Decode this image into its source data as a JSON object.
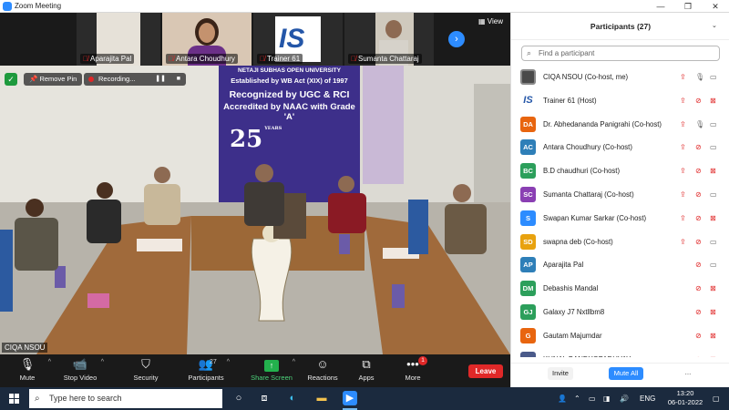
{
  "window": {
    "title": "Zoom Meeting"
  },
  "strip": {
    "view_label": "View",
    "tiles": [
      {
        "name": "Aparajita Pal",
        "muted": true
      },
      {
        "name": "Antara Choudhury",
        "muted": true
      },
      {
        "name": "Trainer 61",
        "muted": true
      },
      {
        "name": "Sumanta Chattaraj",
        "muted": true
      }
    ],
    "next_icon": "chevron-right-icon"
  },
  "overlays": {
    "remove_pin_label": "Remove Pin",
    "recording_label": "Recording...",
    "security_badge_icon": "shield-check-icon"
  },
  "speaker": {
    "name": "CIQA NSOU"
  },
  "banner": {
    "title": "NETAJI SUBHAS OPEN UNIVERSITY",
    "line1": "Established by WB Act (XIX) of 1997",
    "line2": "Recognized by UGC & RCI",
    "line3": "Accredited by NAAC with Grade 'A'",
    "years_num": "25",
    "years_label": "YEARS"
  },
  "toolbar": {
    "mute": "Mute",
    "stop_video": "Stop Video",
    "security": "Security",
    "participants": "Participants",
    "participants_count": "27",
    "share_screen": "Share Screen",
    "reactions": "Reactions",
    "apps": "Apps",
    "more": "More",
    "more_badge": "1",
    "leave": "Leave"
  },
  "panel": {
    "title": "Participants (27)",
    "search_placeholder": "Find a participant",
    "participants": [
      {
        "initials": "",
        "color": "#4a4a4a",
        "name": "CIQA NSOU (Co-host, me)",
        "mic": "on",
        "video": "on",
        "share": true
      },
      {
        "initials": "IS",
        "color": "#ffffff",
        "name": "Trainer 61 (Host)",
        "mic": "muted",
        "video": "off",
        "share": true
      },
      {
        "initials": "DA",
        "color": "#e8650f",
        "name": "Dr. Abhedananda Panigrahi (Co-host)",
        "mic": "on",
        "video": "on",
        "share": true
      },
      {
        "initials": "AC",
        "color": "#2e7fb8",
        "name": "Antara Choudhury (Co-host)",
        "mic": "muted",
        "video": "on",
        "share": true
      },
      {
        "initials": "BC",
        "color": "#2c9f5b",
        "name": "B.D chaudhuri (Co-host)",
        "mic": "muted",
        "video": "off",
        "share": true
      },
      {
        "initials": "SC",
        "color": "#8a3fb3",
        "name": "Sumanta Chattaraj (Co-host)",
        "mic": "muted",
        "video": "on",
        "share": true
      },
      {
        "initials": "S",
        "color": "#2d8cff",
        "name": "Swapan Kumar Sarkar (Co-host)",
        "mic": "muted",
        "video": "off",
        "share": true
      },
      {
        "initials": "SD",
        "color": "#e8a20f",
        "name": "swapna deb (Co-host)",
        "mic": "muted",
        "video": "on",
        "share": true
      },
      {
        "initials": "AP",
        "color": "#2e7fb8",
        "name": "Aparajita Pal",
        "mic": "muted",
        "video": "on",
        "share": false
      },
      {
        "initials": "DM",
        "color": "#2c9f5b",
        "name": "Debashis Mandal",
        "mic": "muted",
        "video": "off",
        "share": false
      },
      {
        "initials": "GJ",
        "color": "#2c9f5b",
        "name": "Galaxy J7 Nxtllbm8",
        "mic": "muted",
        "video": "off",
        "share": false
      },
      {
        "initials": "G",
        "color": "#e8650f",
        "name": "Gautam Majumdar",
        "mic": "muted",
        "video": "off",
        "share": false
      },
      {
        "initials": "KB",
        "color": "#4a5a8a",
        "name": "KUNAL BANDYOPADHYAY",
        "mic": "muted",
        "video": "off",
        "share": false
      }
    ],
    "invite": "Invite",
    "mute_all": "Mute All",
    "more": "..."
  },
  "taskbar": {
    "search_placeholder": "Type here to search",
    "lang": "ENG",
    "time": "13:20",
    "date": "06-01-2022"
  }
}
